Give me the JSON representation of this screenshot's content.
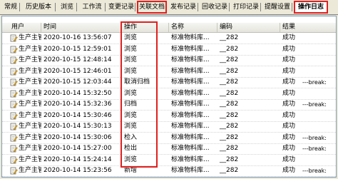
{
  "tabs": [
    {
      "label": "常规"
    },
    {
      "label": "历史版本"
    },
    {
      "label": "浏览"
    },
    {
      "label": "工作流"
    },
    {
      "label": "变更记录"
    },
    {
      "label": "关联文档"
    },
    {
      "label": "发布记录"
    },
    {
      "label": "回收记录"
    },
    {
      "label": "打印记录"
    },
    {
      "label": "提醒设置"
    },
    {
      "label": "操作日志"
    }
  ],
  "columns": {
    "user": "用户",
    "time": "时间",
    "operation": "操作",
    "name": "名称",
    "code": "编码",
    "result": "结果"
  },
  "rows": [
    {
      "user": "生产主管",
      "time": "2020-10-16 13:56:07",
      "op": "浏览",
      "name": "标准物料库...",
      "code": "__282",
      "result": "成功",
      "extra": ""
    },
    {
      "user": "生产主管",
      "time": "2020-10-15 12:59:01",
      "op": "浏览",
      "name": "标准物料库...",
      "code": "__282",
      "result": "成功",
      "extra": ""
    },
    {
      "user": "生产主管",
      "time": "2020-10-15 12:48:14",
      "op": "浏览",
      "name": "标准物料库...",
      "code": "__282",
      "result": "成功",
      "extra": ""
    },
    {
      "user": "生产主管",
      "time": "2020-10-15 12:46:01",
      "op": "浏览",
      "name": "标准物料库...",
      "code": "__282",
      "result": "成功",
      "extra": ""
    },
    {
      "user": "生产主管",
      "time": "2020-10-15 12:03:44",
      "op": "取消归档",
      "name": "标准物料库...",
      "code": "__282",
      "result": "成功",
      "extra": "---break:"
    },
    {
      "user": "生产主管",
      "time": "2020-10-14 15:32:50",
      "op": "浏览",
      "name": "标准物料库...",
      "code": "__282",
      "result": "成功",
      "extra": ""
    },
    {
      "user": "生产主管",
      "time": "2020-10-14 15:32:36",
      "op": "归档",
      "name": "标准物料库...",
      "code": "__282",
      "result": "成功",
      "extra": "---break:"
    },
    {
      "user": "生产主管",
      "time": "2020-10-14 15:30:46",
      "op": "浏览",
      "name": "标准物料库...",
      "code": "__282",
      "result": "成功",
      "extra": ""
    },
    {
      "user": "生产主管",
      "time": "2020-10-14 15:30:13",
      "op": "浏览",
      "name": "标准物料库...",
      "code": "__282",
      "result": "成功",
      "extra": ""
    },
    {
      "user": "生产主管",
      "time": "2020-10-14 15:30:06",
      "op": "检入",
      "name": "标准物料库...",
      "code": "__282",
      "result": "成功",
      "extra": "---break:"
    },
    {
      "user": "生产主管",
      "time": "2020-10-14 15:27:00",
      "op": "检出",
      "name": "标准物料库...",
      "code": "__282",
      "result": "成功",
      "extra": "---break:"
    },
    {
      "user": "生产主管",
      "time": "2020-10-14 15:24:14",
      "op": "浏览",
      "name": "标准物料库...",
      "code": "__282",
      "result": "成功",
      "extra": ""
    },
    {
      "user": "生产主管",
      "time": "2020-10-14 15:23:56",
      "op": "新增",
      "name": "标准物料库...",
      "code": "__282",
      "result": "成功",
      "extra": "---break:"
    }
  ]
}
